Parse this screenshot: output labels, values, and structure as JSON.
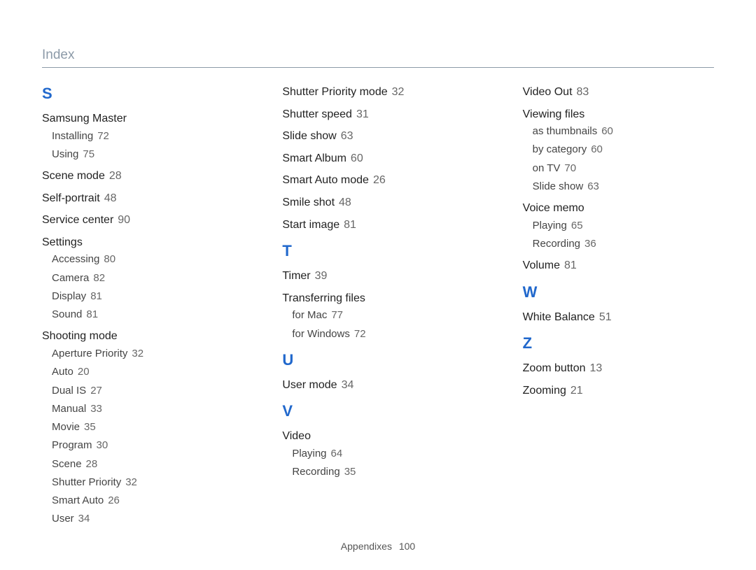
{
  "header": "Index",
  "footer": {
    "label": "Appendixes",
    "page": "100"
  },
  "columns": [
    {
      "groups": [
        {
          "letter": "S",
          "entries": [
            {
              "label": "Samsung Master",
              "page": "",
              "subs": [
                {
                  "label": "Installing",
                  "page": "72"
                },
                {
                  "label": "Using",
                  "page": "75"
                }
              ]
            },
            {
              "label": "Scene mode",
              "page": "28"
            },
            {
              "label": "Self-portrait",
              "page": "48"
            },
            {
              "label": "Service center",
              "page": "90"
            },
            {
              "label": "Settings",
              "page": "",
              "subs": [
                {
                  "label": "Accessing",
                  "page": "80"
                },
                {
                  "label": "Camera",
                  "page": "82"
                },
                {
                  "label": "Display",
                  "page": "81"
                },
                {
                  "label": "Sound",
                  "page": "81"
                }
              ]
            },
            {
              "label": "Shooting mode",
              "page": "",
              "subs": [
                {
                  "label": "Aperture Priority",
                  "page": "32"
                },
                {
                  "label": "Auto",
                  "page": "20"
                },
                {
                  "label": "Dual IS",
                  "page": "27"
                },
                {
                  "label": "Manual",
                  "page": "33"
                },
                {
                  "label": "Movie",
                  "page": "35"
                },
                {
                  "label": "Program",
                  "page": "30"
                },
                {
                  "label": "Scene",
                  "page": "28"
                },
                {
                  "label": "Shutter Priority",
                  "page": "32"
                },
                {
                  "label": "Smart Auto",
                  "page": "26"
                },
                {
                  "label": "User",
                  "page": "34"
                }
              ]
            }
          ]
        }
      ]
    },
    {
      "groups": [
        {
          "letter": "",
          "entries": [
            {
              "label": "Shutter Priority mode",
              "page": "32"
            },
            {
              "label": "Shutter speed",
              "page": "31"
            },
            {
              "label": "Slide show",
              "page": "63"
            },
            {
              "label": "Smart Album",
              "page": "60"
            },
            {
              "label": "Smart Auto mode",
              "page": "26"
            },
            {
              "label": "Smile shot",
              "page": "48"
            },
            {
              "label": "Start image",
              "page": "81"
            }
          ]
        },
        {
          "letter": "T",
          "entries": [
            {
              "label": "Timer",
              "page": "39"
            },
            {
              "label": "Transferring files",
              "page": "",
              "subs": [
                {
                  "label": "for Mac",
                  "page": "77"
                },
                {
                  "label": "for Windows",
                  "page": "72"
                }
              ]
            }
          ]
        },
        {
          "letter": "U",
          "entries": [
            {
              "label": "User mode",
              "page": "34"
            }
          ]
        },
        {
          "letter": "V",
          "entries": [
            {
              "label": "Video",
              "page": "",
              "subs": [
                {
                  "label": "Playing",
                  "page": "64"
                },
                {
                  "label": "Recording",
                  "page": "35"
                }
              ]
            }
          ]
        }
      ]
    },
    {
      "groups": [
        {
          "letter": "",
          "entries": [
            {
              "label": "Video Out",
              "page": "83"
            },
            {
              "label": "Viewing files",
              "page": "",
              "subs": [
                {
                  "label": "as thumbnails",
                  "page": "60"
                },
                {
                  "label": "by category",
                  "page": "60"
                },
                {
                  "label": "on TV",
                  "page": "70"
                },
                {
                  "label": "Slide show",
                  "page": "63"
                }
              ]
            },
            {
              "label": "Voice memo",
              "page": "",
              "subs": [
                {
                  "label": "Playing",
                  "page": "65"
                },
                {
                  "label": "Recording",
                  "page": "36"
                }
              ]
            },
            {
              "label": "Volume",
              "page": "81"
            }
          ]
        },
        {
          "letter": "W",
          "entries": [
            {
              "label": "White Balance",
              "page": "51"
            }
          ]
        },
        {
          "letter": "Z",
          "entries": [
            {
              "label": "Zoom button",
              "page": "13"
            },
            {
              "label": "Zooming",
              "page": "21"
            }
          ]
        }
      ]
    }
  ]
}
